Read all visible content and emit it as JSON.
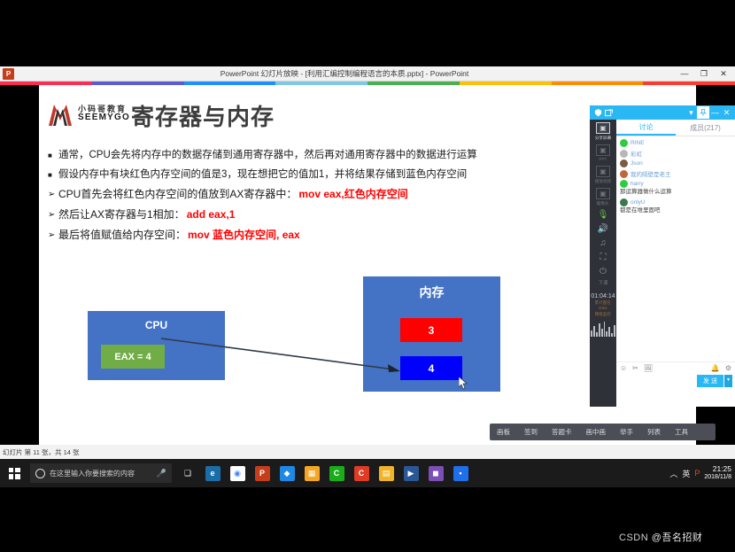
{
  "window": {
    "app_icon": "P",
    "title": "PowerPoint 幻灯片放映 - [利用汇编控制编程语言的本质.pptx] - PowerPoint",
    "minimize": "—",
    "restore": "❐",
    "close": "✕"
  },
  "rainbow_colors": [
    "#ff2d55",
    "#5b5bd6",
    "#1e90ff",
    "#7ec8e3",
    "#4caf50",
    "#ffc107",
    "#ff8c00",
    "#ff3b30"
  ],
  "slide": {
    "logo_cn": "小码哥教育",
    "logo_en": "SEEMYGO",
    "title": "寄存器与内存",
    "bullets": [
      {
        "marker": "■",
        "text": "通常，CPU会先将内存中的数据存储到通用寄存器中，然后再对通用寄存器中的数据进行运算",
        "code": ""
      },
      {
        "marker": "■",
        "text": "假设内存中有块红色内存空间的值是3，现在想把它的值加1，并将结果存储到蓝色内存空间",
        "code": ""
      },
      {
        "marker": "➢",
        "text": "CPU首先会将红色内存空间的值放到AX寄存器中：",
        "code": "mov eax,红色内存空间"
      },
      {
        "marker": "➢",
        "text": "然后让AX寄存器与1相加：",
        "code": "add eax,1"
      },
      {
        "marker": "➢",
        "text": "最后将值赋值给内存空间：",
        "code": "mov 蓝色内存空间, eax"
      }
    ],
    "diagram": {
      "cpu_label": "CPU",
      "eax_label": "EAX = 4",
      "memory_label": "内存",
      "red_cell": "3",
      "blue_cell": "4",
      "colors": {
        "box": "#4472c4",
        "eax": "#70ad47",
        "red": "#ff0000",
        "blue": "#0000ff"
      }
    }
  },
  "video_panel": {
    "header": {
      "logo_icon": "shield-icon",
      "popout_icon": "popout-icon",
      "dropdown_icon": "▾",
      "pin_icon": "pin-icon",
      "minimize": "—",
      "close": "✕"
    },
    "rail": [
      {
        "label": "分享屏幕",
        "icon": "share-screen-icon",
        "active": true
      },
      {
        "label": "PPT",
        "icon": "ppt-icon",
        "active": false
      },
      {
        "label": "播放视频",
        "icon": "play-video-icon",
        "active": false
      },
      {
        "label": "摄像头",
        "icon": "camera-icon",
        "active": false
      }
    ],
    "rail_icons": [
      {
        "name": "mic-icon",
        "glyph": "🎙",
        "color": "green"
      },
      {
        "name": "speaker-icon",
        "glyph": "🔊",
        "color": "gray"
      },
      {
        "name": "music-icon",
        "glyph": "♫",
        "color": "gray"
      },
      {
        "name": "fullscreen-icon",
        "glyph": "⛶",
        "color": "gray"
      }
    ],
    "end_class": {
      "label": "下课",
      "icon": "power-icon"
    },
    "timer": "01:04:14",
    "stats_line1": "累计面包",
    "stats_line2": "1024",
    "stats_line3": "网络监控",
    "tabs": [
      {
        "label": "讨论",
        "active": true
      },
      {
        "label": "成员(217)",
        "active": false
      }
    ],
    "messages": [
      {
        "name": "RINE",
        "text": "",
        "avatar": "#2ecc40"
      },
      {
        "name": "彩虹",
        "text": "",
        "avatar": "#b7b7b7"
      },
      {
        "name": "Json",
        "text": "",
        "avatar": "#7a5c43"
      },
      {
        "name": "我的隔壁是老王",
        "text": "",
        "avatar": "#c1663a"
      },
      {
        "name": "harry",
        "text": "那运算器做什么运算",
        "avatar": "#2ecc40"
      },
      {
        "name": "onlyU",
        "text": "都是在堆里面吧",
        "avatar": "#3a7a4a"
      }
    ],
    "input_tools": [
      {
        "name": "emoji-icon",
        "glyph": "☺"
      },
      {
        "name": "scissors-icon",
        "glyph": "✂"
      },
      {
        "name": "image-icon",
        "glyph": "🖼"
      },
      {
        "name": "at-icon",
        "glyph": "🔔"
      },
      {
        "name": "gear-icon",
        "glyph": "⚙"
      }
    ],
    "send_label": "发 送",
    "send_dropdown": "▾"
  },
  "presenter_toolbar": [
    {
      "label": "画板"
    },
    {
      "label": "签到"
    },
    {
      "label": "答题卡"
    },
    {
      "label": "画中画"
    },
    {
      "label": "举手"
    },
    {
      "label": "列表"
    },
    {
      "label": "工具"
    }
  ],
  "statusbar": {
    "text": "幻灯片 第 11 张，共 14 张"
  },
  "taskbar": {
    "search_placeholder": "在这里输入你要搜索的内容",
    "mic_icon": "🎤",
    "apps": [
      {
        "name": "task-view-icon",
        "glyph": "❏",
        "bg": "transparent",
        "color": "#ffffff"
      },
      {
        "name": "edge-icon",
        "glyph": "e",
        "bg": "#1a6ea8",
        "color": "#ffffff"
      },
      {
        "name": "chrome-icon",
        "glyph": "◉",
        "bg": "#ffffff",
        "color": "#4285f4"
      },
      {
        "name": "powerpoint-icon",
        "glyph": "P",
        "bg": "#c43e1c",
        "color": "#ffffff"
      },
      {
        "name": "cloud-icon",
        "glyph": "◆",
        "bg": "#1e88e5",
        "color": "#ffffff"
      },
      {
        "name": "photos-icon",
        "glyph": "▦",
        "bg": "#f5a623",
        "color": "#ffffff"
      },
      {
        "name": "wechat-icon",
        "glyph": "C",
        "bg": "#1aad19",
        "color": "#ffffff"
      },
      {
        "name": "cdr-icon",
        "glyph": "C",
        "bg": "#e03b24",
        "color": "#ffffff"
      },
      {
        "name": "folder-icon",
        "glyph": "▤",
        "bg": "#f0b429",
        "color": "#ffffff"
      },
      {
        "name": "media-icon",
        "glyph": "▶",
        "bg": "#2b5797",
        "color": "#ffffff"
      },
      {
        "name": "app-icon",
        "glyph": "◼",
        "bg": "#7b4fb5",
        "color": "#ffffff"
      },
      {
        "name": "terminal-icon",
        "glyph": "▪",
        "bg": "#1f6feb",
        "color": "#ffffff"
      }
    ],
    "tray": [
      {
        "name": "chevron-up-icon",
        "glyph": "︿"
      },
      {
        "name": "ime-icon",
        "glyph": "英"
      },
      {
        "name": "ppt-tray-icon",
        "glyph": "P"
      }
    ],
    "time": "21:25",
    "date": "2018/11/8"
  },
  "watermark": {
    "prefix": "CSDN ",
    "text": "@吾名招财"
  }
}
